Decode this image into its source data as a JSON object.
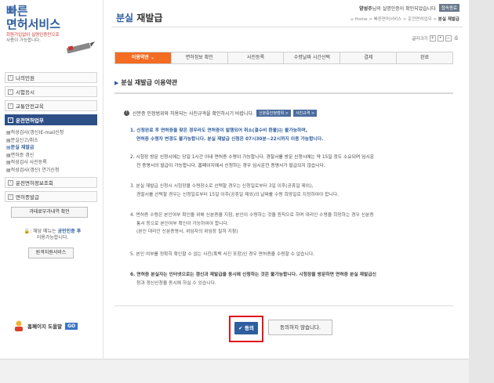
{
  "logo": {
    "line1": "빠른",
    "line2": "면허서비스",
    "sub1": "회원가입없이 실명인증만으로",
    "sub2": "사용이 가능합니다."
  },
  "sidebar": {
    "items": [
      {
        "label": "나의민원",
        "icon": "plus"
      },
      {
        "label": "시험응시",
        "icon": "plus"
      },
      {
        "label": "교통안전교육",
        "icon": "plus"
      },
      {
        "label": "운전면허업무",
        "icon": "minus",
        "active": true
      },
      {
        "label": "운전면허정보조회",
        "icon": "plus"
      },
      {
        "label": "면허증발급",
        "icon": "plus"
      }
    ],
    "submenu": [
      {
        "label": "적성검사(갱신)E-mail신청"
      },
      {
        "label": "분실신고/취소"
      },
      {
        "label": "분실 재발급",
        "selected": true
      },
      {
        "label": "면허증 갱신"
      },
      {
        "label": "적성검사 사진등록"
      },
      {
        "label": "적성검사(갱신) 연기신청"
      }
    ],
    "fine_button": "과태료부과내역 확인",
    "note_pre": "",
    "note_text": ": 해당 메뉴는 ",
    "note_highlight": "공인인증 후",
    "note_post": "이용가능합니다.",
    "remote_button": "원격지원서비스",
    "help_label": "홈페이지 도움말",
    "help_go": "GO"
  },
  "header": {
    "title_blue": "분실",
    "title_rest": "재발급",
    "user_name": "양성주",
    "user_msg": "님의 실명인증이 확인되었습니다",
    "logout": "접속종료",
    "breadcrumb_home": "Home",
    "breadcrumb_1": "빠른면허서비스",
    "breadcrumb_2": "운전면허업무",
    "breadcrumb_3": "분실 재발급",
    "font_size_label": "글자크기"
  },
  "steps": [
    {
      "label": "이용약관",
      "active": true
    },
    {
      "label": "면허정보 확인"
    },
    {
      "label": "사진등록"
    },
    {
      "label": "수령날짜 시간선택"
    },
    {
      "label": "결제"
    },
    {
      "label": "완료"
    }
  ],
  "section": {
    "title": "분실 재발급 이용약관"
  },
  "notice": {
    "text": "신분증 인정범위와 허용되는 사진규격을 확인하시기 바랍니다.",
    "btn1": "신분증인정범위 >",
    "btn2": "사진규격 >"
  },
  "terms": [
    {
      "line1": "1. 신청완료 후 면허증을 찾은 경우라도 면허증이 발행되어 취소(결수비 환불)는 불가능하며,",
      "line2": "면허증 수령자 변경도 불가능합니다. 분실 재발급 신청은 07시30분~22시까지 이용 가능합니다.",
      "style": "red"
    },
    {
      "line1": "2. 시험장 방문 신청시에는 당일 1시간 이내 면허증 수령이 가능합니다. 경찰서를 방문 신청시에는 약 15일 정도 소요되며 임시운",
      "line2": "전 증명서의 발급이 가능합니다. 홈페이지에서 신청하는 경우 임시운전 증명서가 발급되지 않습니다.",
      "style": "strong"
    },
    {
      "line1": "3. 분실 재발급 신청시 시험장을 수령장소로 선택할 경우는 신청일로부터 3일 이후(공휴일 제외),",
      "line2": "경찰서를 선택할 경우는 신청일로부터 15일 이후(공휴일 제외)의 날짜를 수령 희망일로 지정하여야 합니다.",
      "style": "normal"
    },
    {
      "line1": "4. 면허증 수령은 본인여부 확인을 위해 신분증을 지참, 본인이 수령하는 것을 원칙으로 하며 대리인 수령을 희망하는 경우 신분증",
      "line2": "통서 등으로 본인여부 확인이 가능하여야 합니다.",
      "line3": "(본인 대리인 신분증명서, 위임자의 위임장 필히 지참)",
      "style": "normal"
    },
    {
      "line1": "5. 본인 여부를 정확히 확인할 수 없는 사진(흑백 사진 포함)인 경우 면허증을 수령할 수 없습니다.",
      "style": "normal"
    },
    {
      "line1": "6. 면허증 분실자는 인터넷으로는 갱신과 재발급을 동시에 신청하는 것은 불가능합니다. 시험장을 방문하면 면허증 분실 재발급신",
      "line2": "청과 갱신신청을 동시에 하실 수 있습니다.",
      "style": "mixed"
    }
  ],
  "buttons": {
    "agree": "동의",
    "disagree": "동의하지 않습니다."
  },
  "colors": {
    "brand_blue": "#2f5e9f",
    "step_active": "#f36c21",
    "highlight_border": "#e3161c",
    "sidebar_active": "#2d4f87"
  }
}
